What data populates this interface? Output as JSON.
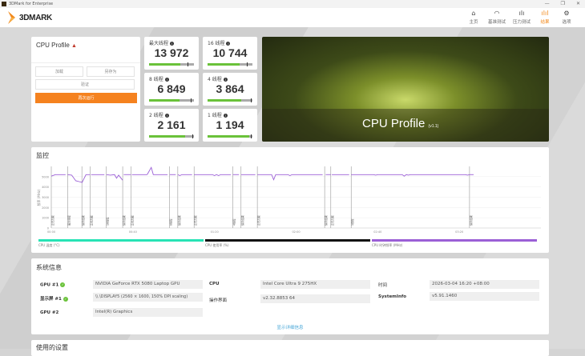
{
  "window": {
    "title": "3DMark for Enterprise",
    "min": "—",
    "max": "❐",
    "close": "✕"
  },
  "logo": "3DMARK",
  "nav": [
    {
      "label": "主页",
      "icon": "home-icon",
      "glyph": "⌂"
    },
    {
      "label": "基准测试",
      "icon": "gauge-icon",
      "glyph": "◠"
    },
    {
      "label": "压力测试",
      "icon": "stress-chart-icon",
      "glyph": "ılı"
    },
    {
      "label": "结果",
      "icon": "results-icon",
      "glyph": "ılıl",
      "active": true
    },
    {
      "label": "选项",
      "icon": "gear-icon",
      "glyph": "⚙"
    }
  ],
  "profile": {
    "title": "CPU Profile",
    "warning_icon": "warning-icon",
    "load": "加载",
    "save_as": "另存为",
    "validate": "验证",
    "run_again": "再次运行",
    "accent": "#f5821f"
  },
  "scores": [
    {
      "label": "最大线程",
      "value": "13 972",
      "fill": 0.7,
      "marker": 0.85
    },
    {
      "label": "16 线程",
      "value": "10 744",
      "fill": 0.72,
      "marker": 0.88
    },
    {
      "label": "8 线程",
      "value": "6 849",
      "fill": 0.68,
      "marker": 0.92
    },
    {
      "label": "4 线程",
      "value": "3 864",
      "fill": 0.75,
      "marker": 0.97
    },
    {
      "label": "2 线程",
      "value": "2 161",
      "fill": 0.8,
      "marker": 0.97
    },
    {
      "label": "1 线程",
      "value": "1 194",
      "fill": 0.92,
      "marker": 0.97
    }
  ],
  "hero": {
    "title": "CPU Profile",
    "version": "(v1.1)"
  },
  "monitor": {
    "title": "监控"
  },
  "chart_data": {
    "type": "line",
    "ylabel": "频率 (MHz)",
    "ylim": [
      0,
      6000
    ],
    "yticks": [
      0,
      1000,
      2000,
      3000,
      4000,
      5000
    ],
    "xticks": [
      "00:00",
      "00:40",
      "01:20",
      "02:00",
      "02:40",
      "03:20"
    ],
    "xlim_seconds": [
      0,
      240
    ],
    "grid": true,
    "markers": [
      {
        "t": 0,
        "label": "正在加载"
      },
      {
        "t": 8,
        "label": "最大线程"
      },
      {
        "t": 15,
        "label": "保存结果"
      },
      {
        "t": 19,
        "label": "正在加载"
      },
      {
        "t": 27,
        "label": "16线程"
      },
      {
        "t": 35,
        "label": "保存结果"
      },
      {
        "t": 39,
        "label": "正在加载"
      },
      {
        "t": 58,
        "label": "8线程"
      },
      {
        "t": 62,
        "label": "保存结果"
      },
      {
        "t": 70,
        "label": "正在加载"
      },
      {
        "t": 89,
        "label": "4线程"
      },
      {
        "t": 93,
        "label": "保存结果"
      },
      {
        "t": 101,
        "label": "正在加载"
      },
      {
        "t": 134,
        "label": "保存结果"
      },
      {
        "t": 137,
        "label": "正在加载"
      },
      {
        "t": 147,
        "label": "1线程"
      },
      {
        "t": 205,
        "label": "保存结果"
      }
    ],
    "series": [
      {
        "name": "CPU 时钟频率 (MHz)",
        "color": "#9b5fd6",
        "segments": [
          [
            [
              0,
              5050
            ],
            [
              2,
              5200
            ],
            [
              7,
              5200
            ]
          ],
          [
            [
              8,
              5200
            ],
            [
              10,
              5150
            ],
            [
              12,
              4600
            ],
            [
              14,
              4500
            ],
            [
              15,
              4450
            ]
          ],
          [
            [
              15,
              4400
            ],
            [
              17,
              5200
            ],
            [
              19,
              5200
            ]
          ],
          [
            [
              19.5,
              5200
            ],
            [
              26,
              5200
            ]
          ],
          [
            [
              27,
              5200
            ],
            [
              29,
              5150
            ],
            [
              31,
              5200
            ],
            [
              32,
              4850
            ],
            [
              33,
              5150
            ],
            [
              35,
              4650
            ]
          ],
          [
            [
              35.5,
              5200
            ],
            [
              39,
              5200
            ]
          ],
          [
            [
              39.5,
              5200
            ],
            [
              47,
              5200
            ]
          ],
          [
            [
              47,
              5200
            ],
            [
              49,
              5900
            ],
            [
              50,
              5200
            ],
            [
              57,
              5200
            ]
          ],
          [
            [
              58,
              5200
            ],
            [
              61,
              5200
            ]
          ],
          [
            [
              62,
              5200
            ],
            [
              63,
              5100
            ],
            [
              64,
              5200
            ],
            [
              69,
              5200
            ]
          ],
          [
            [
              70,
              5200
            ],
            [
              79,
              5200
            ],
            [
              80,
              5100
            ],
            [
              81,
              5200
            ],
            [
              82,
              5100
            ],
            [
              83,
              5200
            ],
            [
              88,
              5200
            ]
          ],
          [
            [
              89,
              5200
            ],
            [
              92,
              5200
            ]
          ],
          [
            [
              93,
              5200
            ],
            [
              100,
              5200
            ]
          ],
          [
            [
              101,
              5200
            ],
            [
              108,
              5200
            ],
            [
              109,
              4700
            ],
            [
              110,
              5200
            ],
            [
              116,
              5200
            ],
            [
              117,
              5100
            ],
            [
              118,
              5200
            ],
            [
              133,
              5200
            ]
          ],
          [
            [
              134.5,
              5200
            ],
            [
              137,
              5200
            ]
          ],
          [
            [
              137.5,
              5200
            ],
            [
              146,
              5200
            ]
          ],
          [
            [
              147,
              5200
            ],
            [
              158,
              5200
            ],
            [
              159,
              5150
            ],
            [
              160,
              5200
            ],
            [
              172,
              5200
            ],
            [
              173,
              5050
            ],
            [
              174,
              5200
            ],
            [
              175,
              5150
            ],
            [
              176,
              5200
            ],
            [
              203,
              5200
            ],
            [
              204,
              5150
            ],
            [
              205,
              5200
            ]
          ],
          [
            [
              205,
              5200
            ],
            [
              207,
              5200
            ]
          ]
        ]
      }
    ],
    "legend": [
      {
        "name": "CPU 温度 (°C)",
        "color": "#27e3b5"
      },
      {
        "name": "CPU 使用率 (%)",
        "color": "#111111"
      },
      {
        "name": "CPU 时钟频率 (MHz)",
        "color": "#9b5fd6"
      }
    ]
  },
  "sysinfo": {
    "title": "系统信息",
    "gpu1_label": "GPU #1",
    "gpu1": "NVIDIA GeForce RTX 5080 Laptop GPU",
    "display_label": "显示屏 #1",
    "display": "\\\\.\\DISPLAY5 (2560 × 1600, 150% DPI scaling)",
    "gpu2_label": "GPU #2",
    "gpu2": "Intel(R) Graphics",
    "cpu_label": "CPU",
    "cpu": "Intel Core Ultra 9 275HX",
    "os_label": "操作界面",
    "os": "v2.32.8853 64",
    "time_label": "时间",
    "time": "2026-03-04 16:20 +08:00",
    "sysinfo_label": "SystemInfo",
    "sysinfo_val": "v5.91.1460",
    "details_link": "显示详细信息"
  },
  "settings": {
    "title": "使用的设置"
  }
}
